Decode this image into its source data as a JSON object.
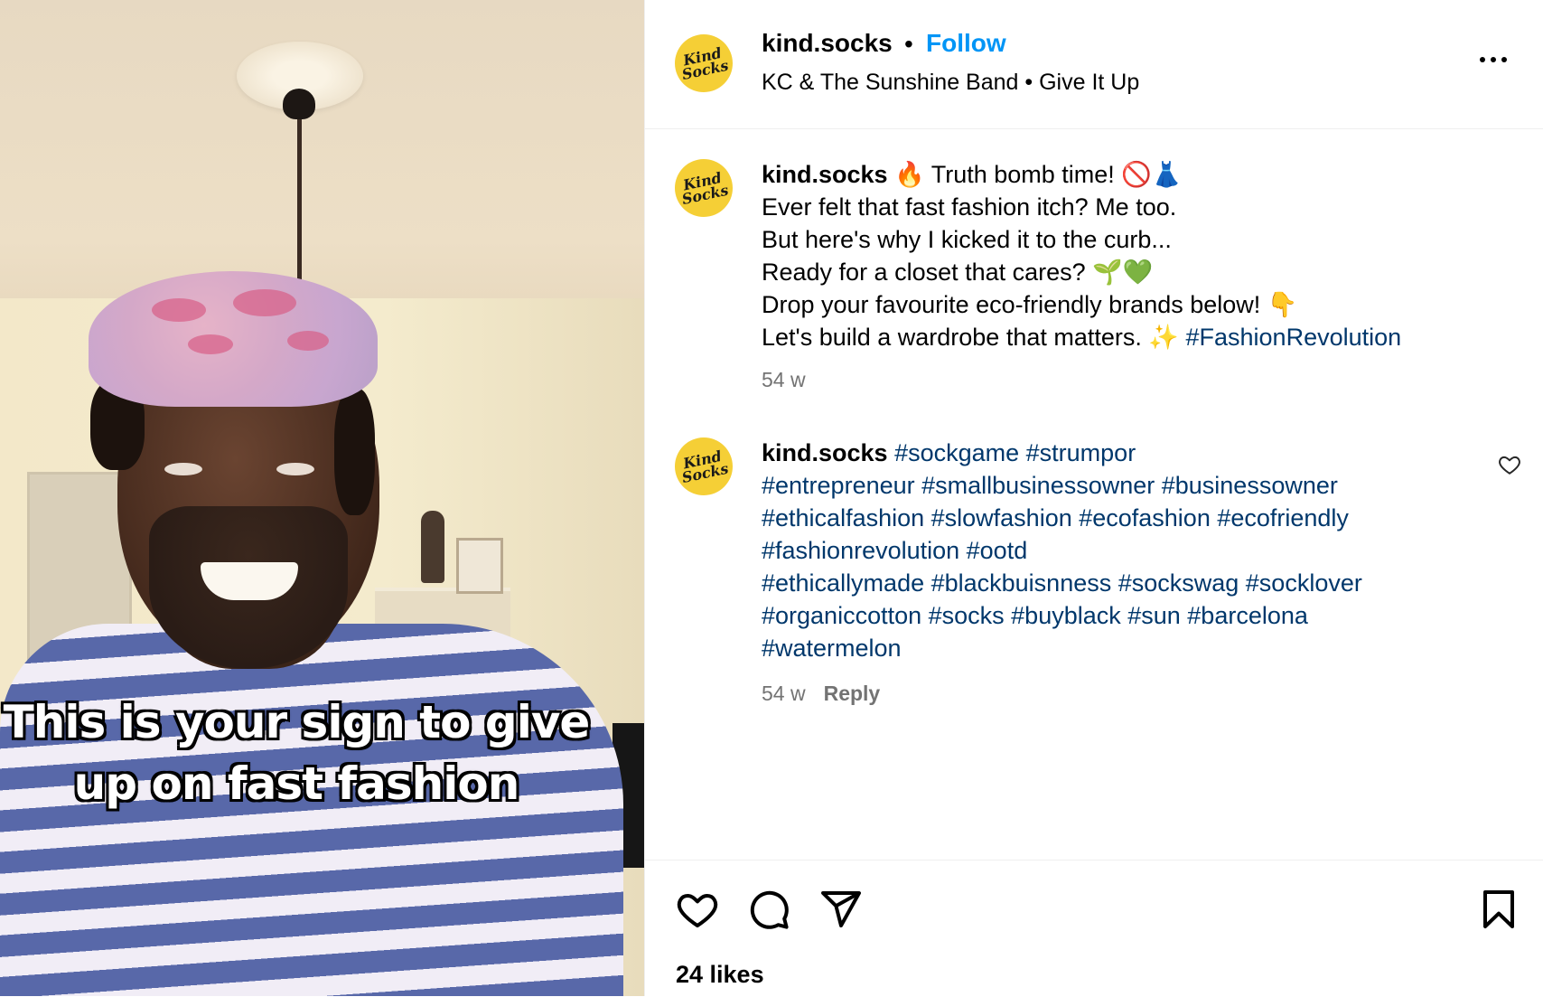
{
  "video": {
    "caption_line1": "This is your sign to give",
    "caption_line2": "up on fast fashion"
  },
  "header": {
    "username": "kind.socks",
    "separator": "•",
    "follow_label": "Follow",
    "music": "KC & The Sunshine Band • Give It Up",
    "avatar_text_top": "Kind",
    "avatar_text_bottom": "Socks"
  },
  "post_caption": {
    "username": "kind.socks",
    "line1": "🔥 Truth bomb time! 🚫👗",
    "line2": "Ever felt that fast fashion itch? Me too.",
    "line3": "But here's why I kicked it to the curb...",
    "line4": "Ready for a closet that cares? 🌱💚",
    "line5": "Drop your favourite eco-friendly brands below! 👇",
    "line6_text": "Let's build a wardrobe that matters. ✨ ",
    "line6_tag": "#FashionRevolution",
    "time": "54 w"
  },
  "comment": {
    "username": "kind.socks",
    "tags_line1": "#sockgame #strumpor",
    "tags_line2": "#entrepreneur #smallbusinessowner #businessowner",
    "tags_line3": "#ethicalfashion #slowfashion #ecofashion #ecofriendly",
    "tags_line4": "#fashionrevolution #ootd",
    "tags_line5": "#ethicallymade #blackbuisnness #sockswag #socklover",
    "tags_line6": "#organiccotton #socks #buyblack #sun #barcelona",
    "tags_line7": "#watermelon",
    "time": "54 w",
    "reply_label": "Reply"
  },
  "actions": {
    "icons": [
      "heart-icon",
      "comment-icon",
      "share-icon",
      "bookmark-icon"
    ],
    "likes": "24 likes"
  },
  "colors": {
    "follow": "#0095f6",
    "hashtag": "#00376b",
    "meta": "#737373",
    "avatar_bg": "#f5cf36"
  }
}
